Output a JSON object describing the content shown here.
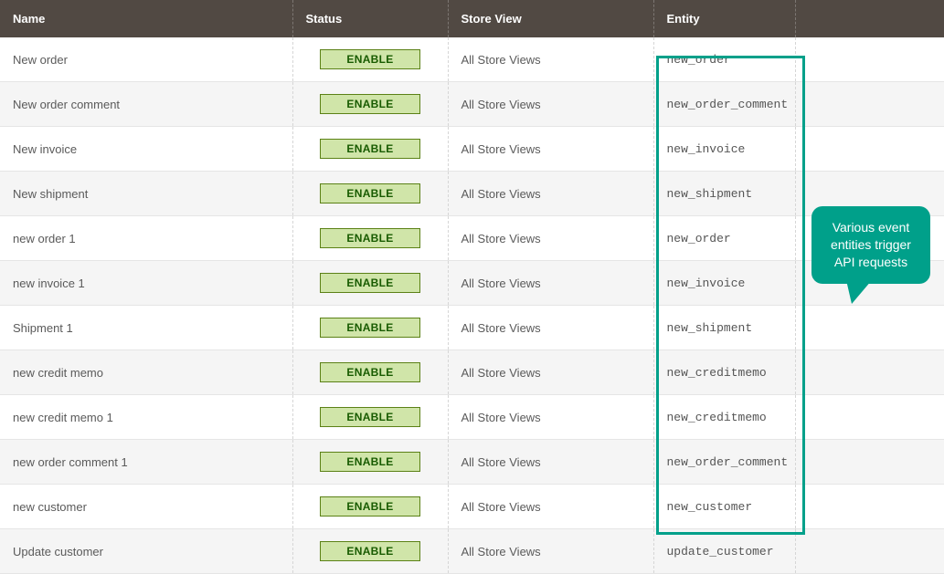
{
  "columns": {
    "name": "Name",
    "status": "Status",
    "store": "Store View",
    "entity": "Entity"
  },
  "status_label": "ENABLE",
  "rows": [
    {
      "name": "New order",
      "store": "All Store Views",
      "entity": "new_order"
    },
    {
      "name": "New order comment",
      "store": "All Store Views",
      "entity": "new_order_comment"
    },
    {
      "name": "New invoice",
      "store": "All Store Views",
      "entity": "new_invoice"
    },
    {
      "name": "New shipment",
      "store": "All Store Views",
      "entity": "new_shipment"
    },
    {
      "name": "new order 1",
      "store": "All Store Views",
      "entity": "new_order"
    },
    {
      "name": "new invoice 1",
      "store": "All Store Views",
      "entity": "new_invoice"
    },
    {
      "name": "Shipment 1",
      "store": "All Store Views",
      "entity": "new_shipment"
    },
    {
      "name": "new credit memo",
      "store": "All Store Views",
      "entity": "new_creditmemo"
    },
    {
      "name": "new credit memo 1",
      "store": "All Store Views",
      "entity": "new_creditmemo"
    },
    {
      "name": "new order comment 1",
      "store": "All Store Views",
      "entity": "new_order_comment"
    },
    {
      "name": "new customer",
      "store": "All Store Views",
      "entity": "new_customer"
    },
    {
      "name": "Update customer",
      "store": "All Store Views",
      "entity": "update_customer"
    }
  ],
  "callout": {
    "text": "Various event entities trigger API requests"
  },
  "colors": {
    "header_bg": "#514943",
    "badge_bg": "#d0e5a9",
    "badge_border": "#5b8116",
    "badge_text": "#185b00",
    "highlight": "#00a08a"
  }
}
